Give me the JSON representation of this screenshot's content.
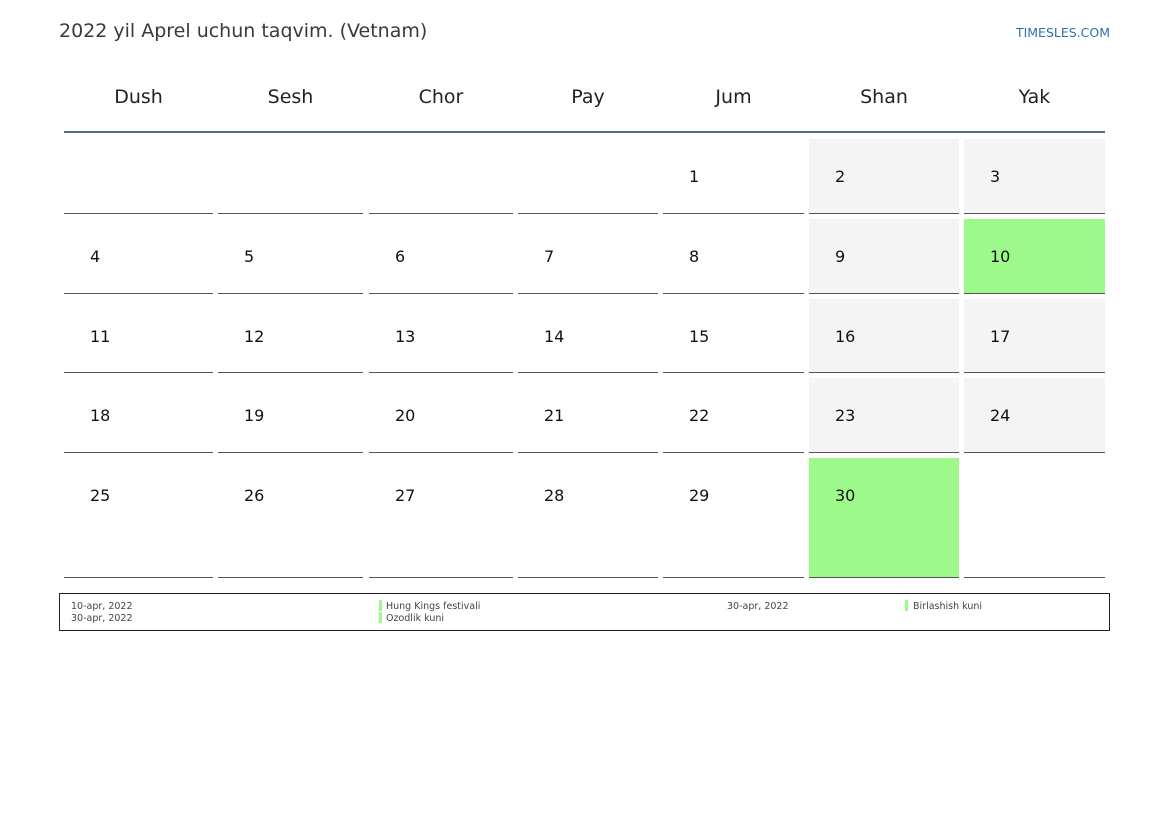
{
  "header": {
    "title": "2022 yil Aprel uchun taqvim. (Vetnam)",
    "site_link": "TIMESLES.COM"
  },
  "calendar": {
    "weekdays": [
      "Dush",
      "Sesh",
      "Chor",
      "Pay",
      "Jum",
      "Shan",
      "Yak"
    ],
    "weeks": [
      [
        "",
        "",
        "",
        "",
        "1",
        "2",
        "3"
      ],
      [
        "4",
        "5",
        "6",
        "7",
        "8",
        "9",
        "10"
      ],
      [
        "11",
        "12",
        "13",
        "14",
        "15",
        "16",
        "17"
      ],
      [
        "18",
        "19",
        "20",
        "21",
        "22",
        "23",
        "24"
      ],
      [
        "25",
        "26",
        "27",
        "28",
        "29",
        "30",
        ""
      ]
    ],
    "holiday_days": [
      "10",
      "30"
    ]
  },
  "legend": {
    "entries": [
      {
        "date": "10-apr, 2022",
        "name": "Hung Kings festivali"
      },
      {
        "date": "30-apr, 2022",
        "name": "Ozodlik kuni"
      },
      {
        "date": "30-apr, 2022",
        "name": "Birlashish kuni"
      }
    ]
  },
  "colors": {
    "holiday": "#9dfa8a",
    "weekend": "#f4f4f4",
    "header_rule": "#4e6f94",
    "link": "#2f6fb0"
  }
}
